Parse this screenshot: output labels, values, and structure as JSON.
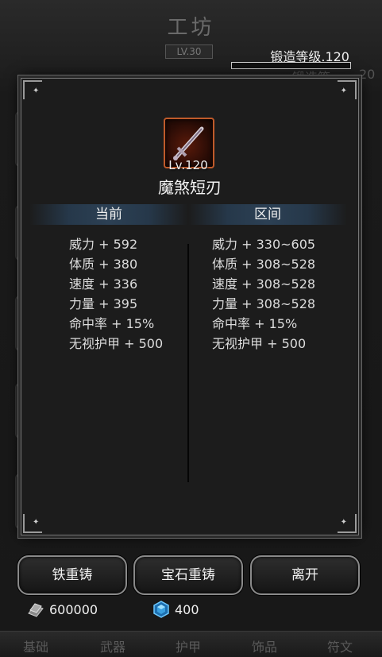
{
  "background": {
    "title": "工坊",
    "level": "LV.30",
    "forge_label": "锻造等",
    "forge_value": "20"
  },
  "forge": {
    "label": "锻造等级.120",
    "progress": 0.0
  },
  "item": {
    "level": "Lv.120",
    "name": "魔煞短刃",
    "icon": "dagger-icon"
  },
  "columns": {
    "current": "当前",
    "range": "区间"
  },
  "current_stats": [
    "威力 + 592",
    "体质 + 380",
    "速度 + 336",
    "力量 + 395",
    "命中率 + 15%",
    "无视护甲 + 500"
  ],
  "range_stats": [
    "威力 + 330~605",
    "体质 + 308~528",
    "速度 + 308~528",
    "力量 + 308~528",
    "命中率 + 15%",
    "无视护甲 + 500"
  ],
  "buttons": {
    "iron_reforge": "铁重铸",
    "gem_reforge": "宝石重铸",
    "leave": "离开"
  },
  "currency": {
    "iron": "600000",
    "gem": "400",
    "iron_icon": "iron-ingot-icon",
    "gem_icon": "blue-gem-icon"
  },
  "tabs": [
    "基础",
    "武器",
    "护甲",
    "饰品",
    "符文"
  ],
  "colors": {
    "icon_border": "#c05a2a",
    "header_band": "#2c4054",
    "gem": "#3aa0e0"
  }
}
